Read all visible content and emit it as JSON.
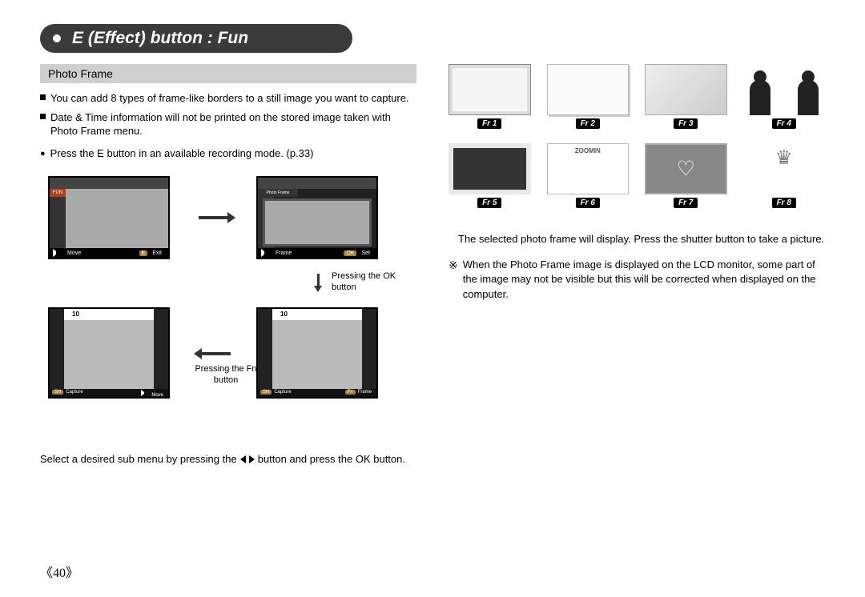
{
  "title": "E (Effect) button : Fun",
  "section_header": "Photo Frame",
  "bullets": [
    "You can add 8 types of frame-like borders to a still image you want to capture.",
    "Date & Time information will not be printed on the stored image taken with Photo Frame menu."
  ],
  "instruction_main": "Press the E button in an available recording mode. (p.33)",
  "diagram": {
    "fun_label": "FUN",
    "photo_frame_label": "Photo Frame",
    "move": "Move",
    "exit_key": "E",
    "exit": "Exit",
    "frame": "Frame",
    "ok_key": "OK",
    "set": "Set",
    "pressing_ok": "Pressing the OK button",
    "pressing_fn": "Pressing the Fn button",
    "count": "10",
    "sh_key": "SH",
    "capture": "Capture",
    "fn_key": "Fn"
  },
  "bottom_instruction_pre": "Select a desired sub menu by pressing the ",
  "bottom_instruction_post": " button and press the OK button.",
  "frame_labels": [
    "Fr 1",
    "Fr 2",
    "Fr 3",
    "Fr 4",
    "Fr 5",
    "Fr 6",
    "Fr 7",
    "Fr 8"
  ],
  "zoomin_text": "ZOOMIN",
  "right_text_1": "The selected photo frame will display. Press the shutter button to take a picture.",
  "right_note": "When the Photo Frame image is displayed on the LCD monitor, some part of the image may not be visible but this will be corrected when displayed on the computer.",
  "page_number": "《40》"
}
